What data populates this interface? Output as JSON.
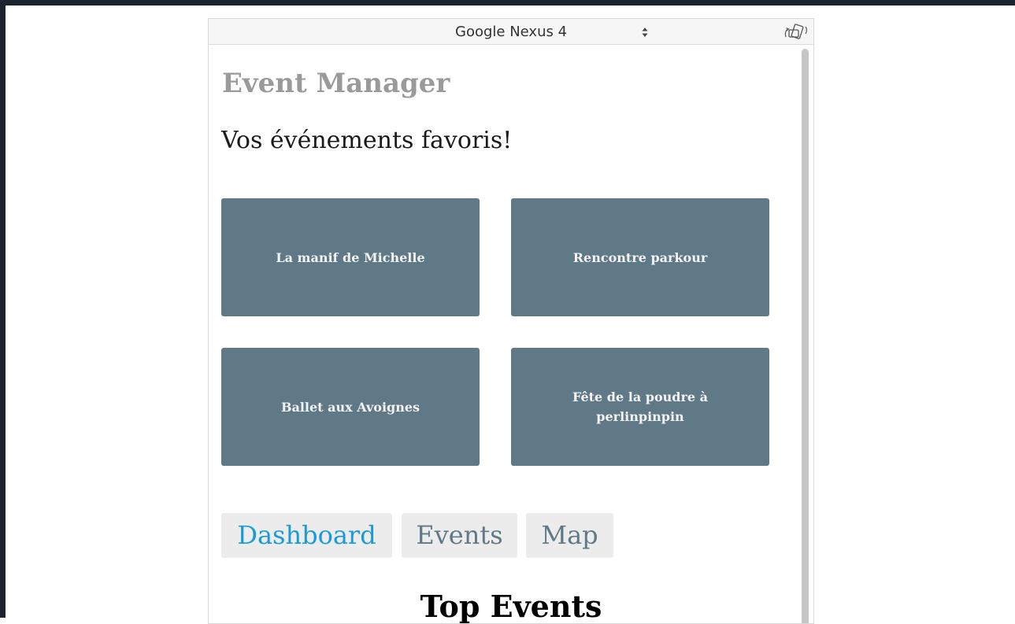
{
  "device_toolbar": {
    "device_name": "Google Nexus 4",
    "select_icon": "updown-arrows-icon",
    "rotate_icon": "rotate-device-icon"
  },
  "app": {
    "title": "Event Manager",
    "subtitle": "Vos événements favoris!",
    "favorite_events": [
      {
        "label": "La manif de Michelle"
      },
      {
        "label": "Rencontre parkour"
      },
      {
        "label": "Ballet aux Avoignes"
      },
      {
        "label": "Fête de la poudre à perlinpinpin"
      }
    ],
    "tabs": [
      {
        "label": "Dashboard",
        "active": true
      },
      {
        "label": "Events",
        "active": false
      },
      {
        "label": "Map",
        "active": false
      }
    ],
    "section_title": "Top Events"
  },
  "colors": {
    "card_bg": "#607987",
    "card_text": "#f3f3f3",
    "title_gray": "#9a9a9a",
    "tab_active": "#1a9bd7",
    "tab_inactive": "#607987",
    "tab_bg": "#ececec",
    "frame_dark": "#1d2430"
  }
}
